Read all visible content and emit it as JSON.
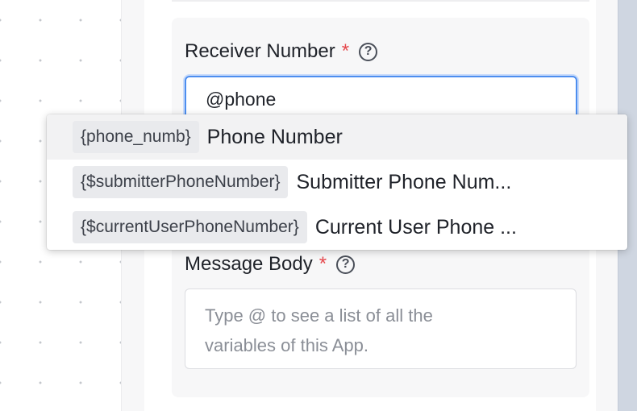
{
  "receiver": {
    "label": "Receiver Number",
    "required_mark": "*",
    "help": "?",
    "value": "@phone"
  },
  "message": {
    "label": "Message Body",
    "required_mark": "*",
    "help": "?",
    "placeholder_line1": "Type @ to see a list of all the",
    "placeholder_line2": "variables of this App."
  },
  "suggestions": [
    {
      "tag": "{phone_numb}",
      "label": "Phone Number"
    },
    {
      "tag": "{$submitterPhoneNumber}",
      "label": "Submitter Phone Num..."
    },
    {
      "tag": "{$currentUserPhoneNumber}",
      "label": "Current User Phone ..."
    }
  ],
  "colors": {
    "required": "#e5484d",
    "focus_border": "#4d8eef"
  }
}
